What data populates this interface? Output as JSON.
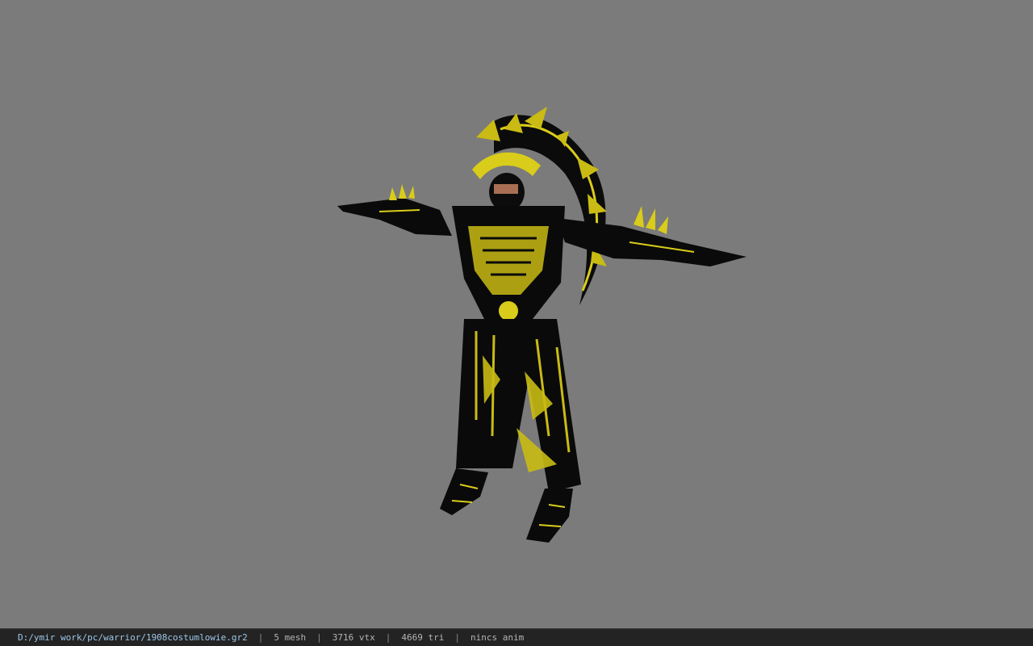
{
  "viewport": {
    "background_color": "#7b7b7b",
    "model": {
      "armor_color": "#0a0a0a",
      "trim_color": "#d9cc1a",
      "skin_color": "#a86f55"
    }
  },
  "status_bar": {
    "file_path": "D:/ymir work/pc/warrior/1908costumlowie.gr2",
    "separator": "|",
    "mesh": "5 mesh",
    "vertices": "3716 vtx",
    "triangles": "4669 tri",
    "animation": "nincs anim"
  }
}
